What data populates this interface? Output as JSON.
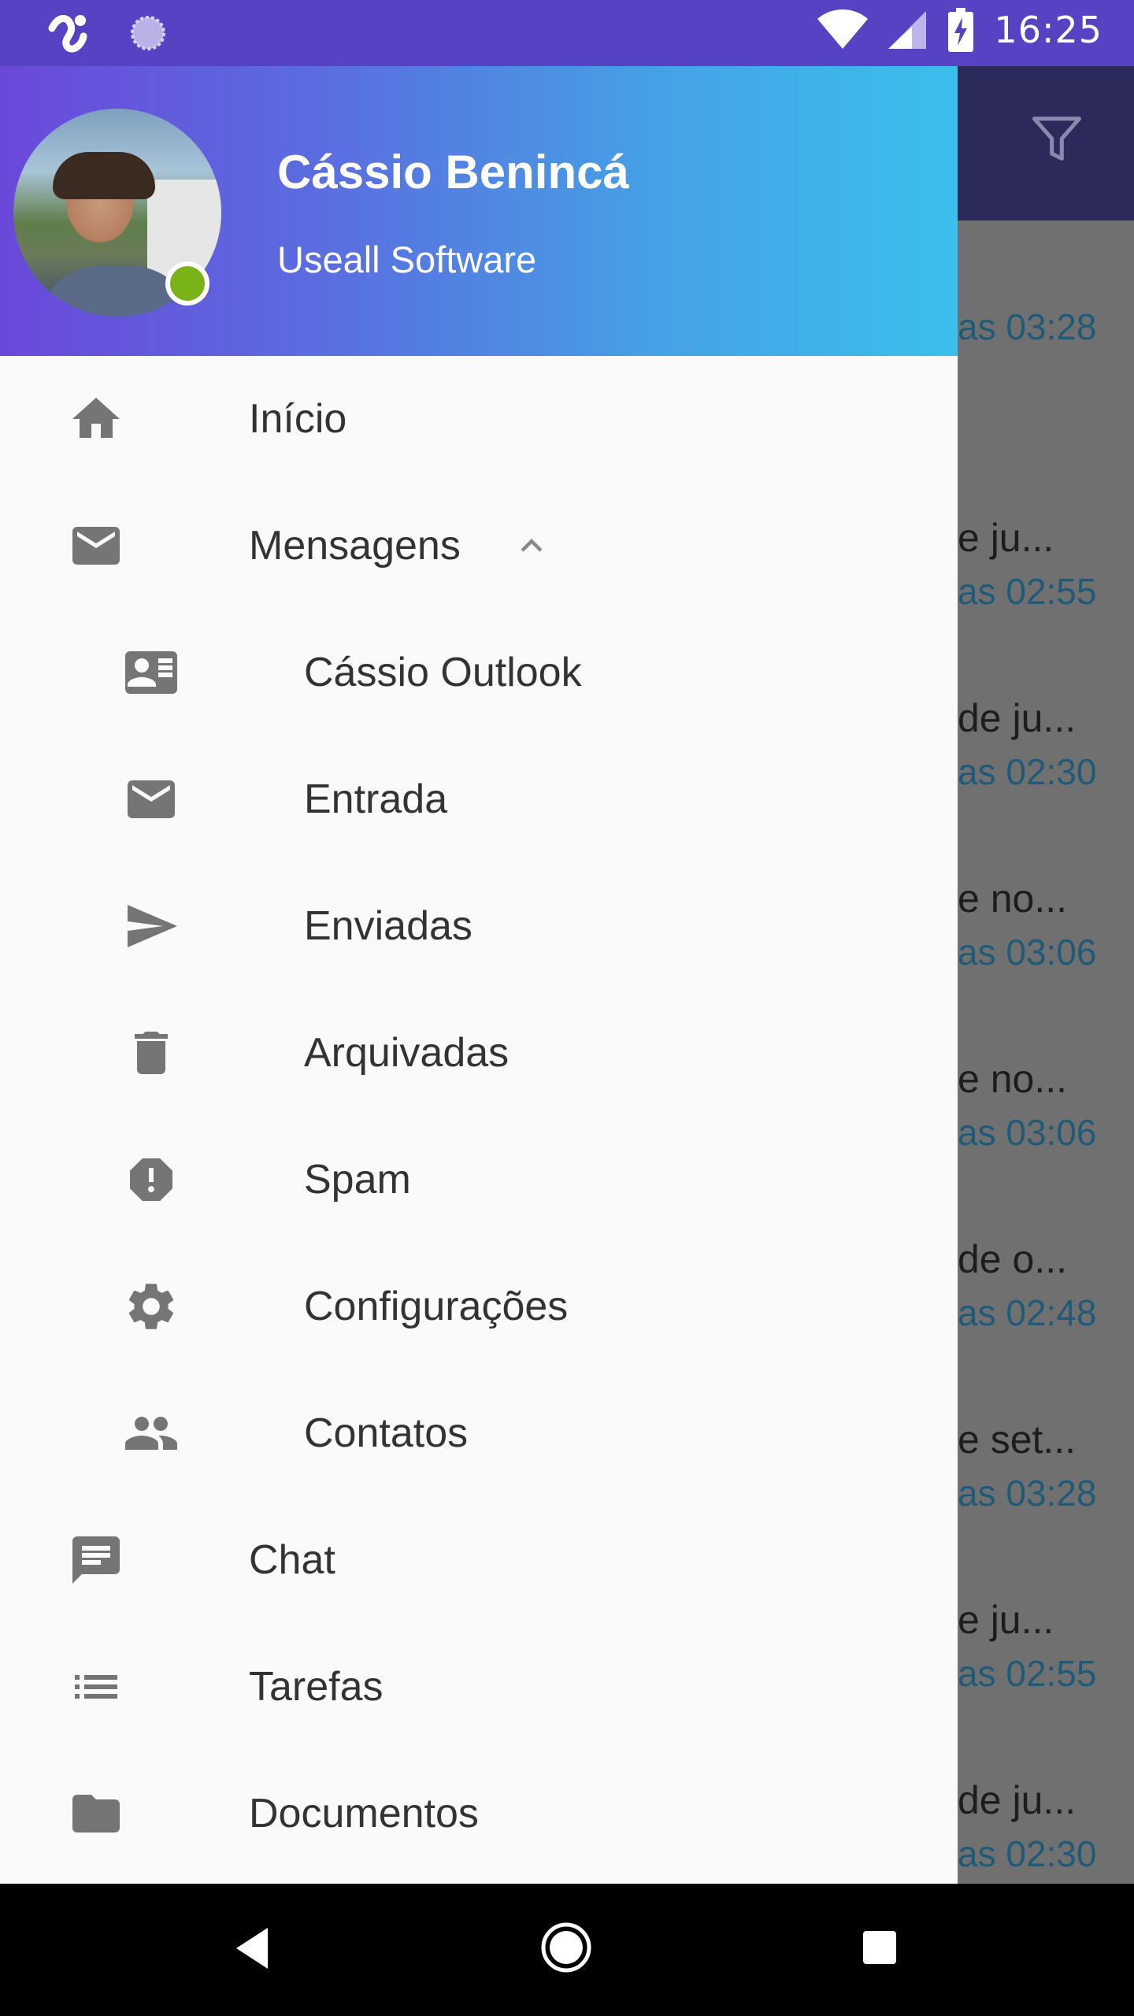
{
  "status_bar": {
    "time": "16:25",
    "icons": [
      "app-logo-icon",
      "sync-icon",
      "wifi-icon",
      "signal-icon",
      "battery-charging-icon"
    ]
  },
  "background_list": {
    "items": [
      {
        "subject": "",
        "time": "as 03:28"
      },
      {
        "subject": "e ju...",
        "time": "as 02:55"
      },
      {
        "subject": "de ju...",
        "time": "as 02:30"
      },
      {
        "subject": "e no...",
        "time": "as 03:06"
      },
      {
        "subject": "e no...",
        "time": "as 03:06"
      },
      {
        "subject": "de o...",
        "time": "as 02:48"
      },
      {
        "subject": "e set...",
        "time": "as 03:28"
      },
      {
        "subject": "e ju...",
        "time": "as 02:55"
      },
      {
        "subject": "de ju...",
        "time": "as 02:30"
      }
    ]
  },
  "drawer": {
    "header": {
      "name": "Cássio Benincá",
      "company": "Useall Software",
      "status_color": "#7ab317"
    },
    "menu": [
      {
        "label": "Início",
        "icon": "home-icon",
        "level": 1
      },
      {
        "label": "Mensagens",
        "icon": "mail-icon",
        "level": 1,
        "expanded": true
      },
      {
        "label": "Cássio Outlook",
        "icon": "contact-mail-icon",
        "level": 2
      },
      {
        "label": "Entrada",
        "icon": "mail-icon",
        "level": 2
      },
      {
        "label": "Enviadas",
        "icon": "send-icon",
        "level": 2
      },
      {
        "label": "Arquivadas",
        "icon": "trash-icon",
        "level": 2
      },
      {
        "label": "Spam",
        "icon": "report-icon",
        "level": 2
      },
      {
        "label": "Configurações",
        "icon": "gear-icon",
        "level": 2
      },
      {
        "label": "Contatos",
        "icon": "people-icon",
        "level": 2
      },
      {
        "label": "Chat",
        "icon": "chat-icon",
        "level": 1
      },
      {
        "label": "Tarefas",
        "icon": "list-icon",
        "level": 1
      },
      {
        "label": "Documentos",
        "icon": "folder-icon",
        "level": 1
      }
    ]
  },
  "colors": {
    "status_bar": "#5543c4",
    "header_gradient_start": "#6a48d9",
    "header_gradient_end": "#3bbfeb",
    "icon_gray": "#757575",
    "time_blue": "#1f5b78"
  }
}
